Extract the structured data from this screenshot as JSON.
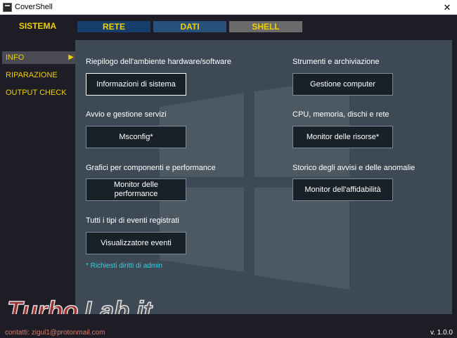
{
  "window": {
    "title": "CoverShell",
    "close_label": "✕"
  },
  "tabs": [
    {
      "label": "SISTEMA"
    },
    {
      "label": "RETE"
    },
    {
      "label": "DATI"
    },
    {
      "label": "SHELL"
    }
  ],
  "sidebar": {
    "items": [
      {
        "label": "INFO",
        "arrow": "▶"
      },
      {
        "label": "RIPARAZIONE"
      },
      {
        "label": "OUTPUT CHECK"
      }
    ]
  },
  "sections": {
    "riepilogo": {
      "heading": "Riepilogo dell'ambiente hardware/software",
      "button": "Informazioni di sistema"
    },
    "avvio": {
      "heading": "Avvio e gestione servizi",
      "button": "Msconfig*"
    },
    "grafici": {
      "heading": "Grafici per componenti e performance",
      "button": "Monitor delle performance"
    },
    "eventi": {
      "heading": "Tutti i tipi di eventi registrati",
      "button": "Visualizzatore eventi"
    },
    "strumenti": {
      "heading": "Strumenti e archiviazione",
      "button": "Gestione computer"
    },
    "cpu": {
      "heading": "CPU, memoria, dischi e rete",
      "button": "Monitor delle risorse*"
    },
    "storico": {
      "heading": "Storico degli avvisi e delle anomalie",
      "button": "Monitor dell'affidabilità"
    }
  },
  "note": "* Richiesti diritti di admin",
  "footer": {
    "contact": "contatti: zigul1@protonmail.com",
    "version": "v. 1.0.0"
  },
  "watermark": {
    "text": "TurboLab.it"
  }
}
